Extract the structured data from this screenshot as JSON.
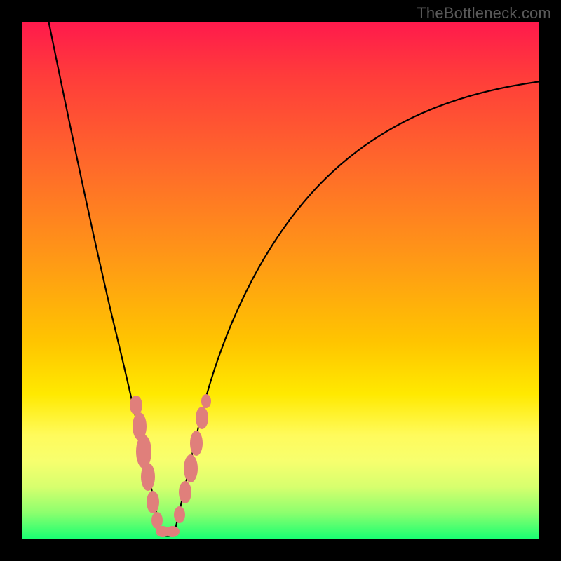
{
  "watermark": "TheBottleneck.com",
  "chart_data": {
    "type": "line",
    "title": "",
    "xlabel": "",
    "ylabel": "",
    "xlim": [
      0,
      100
    ],
    "ylim": [
      0,
      100
    ],
    "grid": false,
    "legend": false,
    "series": [
      {
        "name": "left-branch",
        "x": [
          4,
          6,
          8,
          10,
          12,
          14,
          16,
          18,
          20,
          21,
          22,
          23,
          24,
          25,
          26
        ],
        "y": [
          100,
          90,
          80,
          70,
          60,
          50,
          40,
          30,
          20,
          14,
          10,
          6,
          3,
          1,
          0
        ]
      },
      {
        "name": "right-branch",
        "x": [
          26,
          28,
          30,
          32,
          35,
          40,
          45,
          50,
          55,
          60,
          65,
          70,
          75,
          80,
          85,
          90,
          95,
          100
        ],
        "y": [
          0,
          4,
          10,
          16,
          25,
          38,
          48,
          55,
          61,
          66,
          70,
          73,
          76,
          79,
          81,
          83,
          85,
          87
        ]
      }
    ],
    "annotations": [
      {
        "name": "salmon-blobs-left",
        "x_range": [
          19,
          26
        ],
        "y_range": [
          0,
          27
        ],
        "color": "#e07f7b"
      },
      {
        "name": "salmon-blobs-right",
        "x_range": [
          27,
          33
        ],
        "y_range": [
          2,
          26
        ],
        "color": "#e07f7b"
      }
    ]
  },
  "colors": {
    "gradient_top": "#ff1a4c",
    "gradient_mid": "#ffe900",
    "gradient_bottom": "#1aff72",
    "curve": "#000000",
    "blob": "#e07f7b",
    "frame": "#000000",
    "watermark": "#5a5a5a"
  }
}
